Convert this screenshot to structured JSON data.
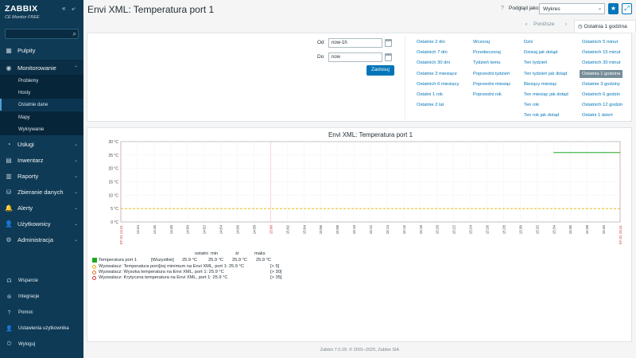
{
  "sidebar": {
    "logo": "ZABBIX",
    "edition": "CE Monitor FREE",
    "nav": [
      {
        "label": "Pulpity",
        "icon": "dashboard-icon",
        "glyph": "▦"
      },
      {
        "label": "Monitorowanie",
        "icon": "eye-icon",
        "glyph": "◉"
      },
      {
        "label": "Usługi",
        "icon": "services-icon",
        "glyph": "◔"
      },
      {
        "label": "Inwentarz",
        "icon": "inventory-icon",
        "glyph": "▤"
      },
      {
        "label": "Raporty",
        "icon": "reports-icon",
        "glyph": "▥"
      },
      {
        "label": "Zbieranie danych",
        "icon": "data-collection-icon",
        "glyph": "⛁"
      },
      {
        "label": "Alerty",
        "icon": "bell-icon",
        "glyph": "🔔"
      },
      {
        "label": "Użytkownicy",
        "icon": "users-icon",
        "glyph": "👤"
      },
      {
        "label": "Administracja",
        "icon": "gear-icon",
        "glyph": "⚙"
      }
    ],
    "submenu": [
      "Problemy",
      "Hosty",
      "Ostatnie dane",
      "Mapy",
      "Wykrywanie"
    ],
    "bottom": [
      {
        "label": "Wsparcie",
        "icon": "support-icon",
        "glyph": "☊"
      },
      {
        "label": "Integracje",
        "icon": "integrations-icon",
        "glyph": "⊛"
      },
      {
        "label": "Pomoc",
        "icon": "help-icon",
        "glyph": "?"
      },
      {
        "label": "Ustawienia użytkownika",
        "icon": "user-settings-icon",
        "glyph": "👤"
      },
      {
        "label": "Wyloguj",
        "icon": "logout-icon",
        "glyph": "⏻"
      }
    ]
  },
  "header": {
    "title": "Envi XML: Temperatura port 1",
    "help": "?",
    "view_as": "Podgląd jako",
    "view_value": "Wykres"
  },
  "tabs": {
    "prev": "Poniższe",
    "period": "Ostatnia 1 godzina"
  },
  "filter": {
    "from_label": "Od",
    "from_value": "now-1h",
    "to_label": "Do",
    "to_value": "now",
    "apply": "Zastosuj",
    "col1": [
      "Ostatnie 2 dni",
      "Ostatnich 7 dni",
      "Ostatnich 30 dni",
      "Ostatnie 3 miesiące",
      "Ostatnich 6 miesięcy",
      "Ostatni 1 rok",
      "Ostatnie 2 lat"
    ],
    "col2": [
      "Wczoraj",
      "Przedwczoraj",
      "Tydzień temu",
      "Poprzedni tydzień",
      "Poprzedni miesiąc",
      "Poprzedni rok"
    ],
    "col3": [
      "Dziś",
      "Dzisiaj jak dotąd",
      "Ten tydzień",
      "Ten tydzień jak dotąd",
      "Bieżący miesiąc",
      "Ten miesiąc jak dotąd",
      "Ten rok",
      "Ten rok jak dotąd"
    ],
    "col4": [
      "Ostatnich 5 minut",
      "Ostatnich 15 minut",
      "Ostatnich 30 minut",
      "Ostatnia 1 godzina",
      "Ostatnie 3 godziny",
      "Ostatnich 6 godzin",
      "Ostatnich 12 godzin",
      "Ostatni 1 dzień"
    ]
  },
  "legend": {
    "headers": {
      "last": "ostatni",
      "min": "min",
      "avg": "śr",
      "max": "maks"
    },
    "item": {
      "name": "Temperatura port 1",
      "scope": "[Wszystkie]",
      "last": "25.9 °C",
      "min": "25.9 °C",
      "avg": "25.9 °C",
      "max": "25.9 °C",
      "color": "#1fa81f"
    },
    "triggers": [
      {
        "text": "Wyzwalacz: Temperatura poni[żej minimum na Envi XML, port 1: 25.9 °C",
        "cond": "[< 5]",
        "color": "#e8b000"
      },
      {
        "text": "Wyzwalacz: Wysoka temperatura na Envi XML, port 1: 25.9 °C",
        "cond": "[> 30]",
        "color": "#e07030"
      },
      {
        "text": "Wyzwalacz: Krytyczna temperatura na Envi XML, port 1: 25.9 °C",
        "cond": "[> 35]",
        "color": "#d03030"
      }
    ]
  },
  "chart_data": {
    "type": "line",
    "title": "Envi XML: Temperatura port 1",
    "ylim": [
      0,
      30
    ],
    "yticks": [
      "0 °C",
      "5 °C",
      "10 °C",
      "15 °C",
      "20 °C",
      "25 °C",
      "30 °C"
    ],
    "xticks": [
      {
        "t": "07-31 14:41",
        "red": true
      },
      {
        "t": "14:44"
      },
      {
        "t": "14:46"
      },
      {
        "t": "14:48"
      },
      {
        "t": "14:50"
      },
      {
        "t": "14:52"
      },
      {
        "t": "14:54"
      },
      {
        "t": "14:56"
      },
      {
        "t": "14:58"
      },
      {
        "t": "15:00",
        "red": true
      },
      {
        "t": "15:02"
      },
      {
        "t": "15:04"
      },
      {
        "t": "15:06"
      },
      {
        "t": "15:08"
      },
      {
        "t": "15:10"
      },
      {
        "t": "15:12"
      },
      {
        "t": "15:14"
      },
      {
        "t": "15:16"
      },
      {
        "t": "15:18"
      },
      {
        "t": "15:20"
      },
      {
        "t": "15:22"
      },
      {
        "t": "15:24"
      },
      {
        "t": "15:26"
      },
      {
        "t": "15:28"
      },
      {
        "t": "15:30"
      },
      {
        "t": "15:32"
      },
      {
        "t": "15:34"
      },
      {
        "t": "15:36"
      },
      {
        "t": "15:38"
      },
      {
        "t": "15:40"
      },
      {
        "t": "07-31 15:41",
        "red": true
      }
    ],
    "series": [
      {
        "name": "Temperatura port 1",
        "color": "#1fa81f",
        "x_start": "15:34",
        "x_end": "15:41",
        "value": 25.9
      }
    ],
    "threshold": {
      "value": 5,
      "color": "#e8b000"
    }
  },
  "footer": "Zabbix 7.0.29. © 2001–2025, Zabbix SIA"
}
